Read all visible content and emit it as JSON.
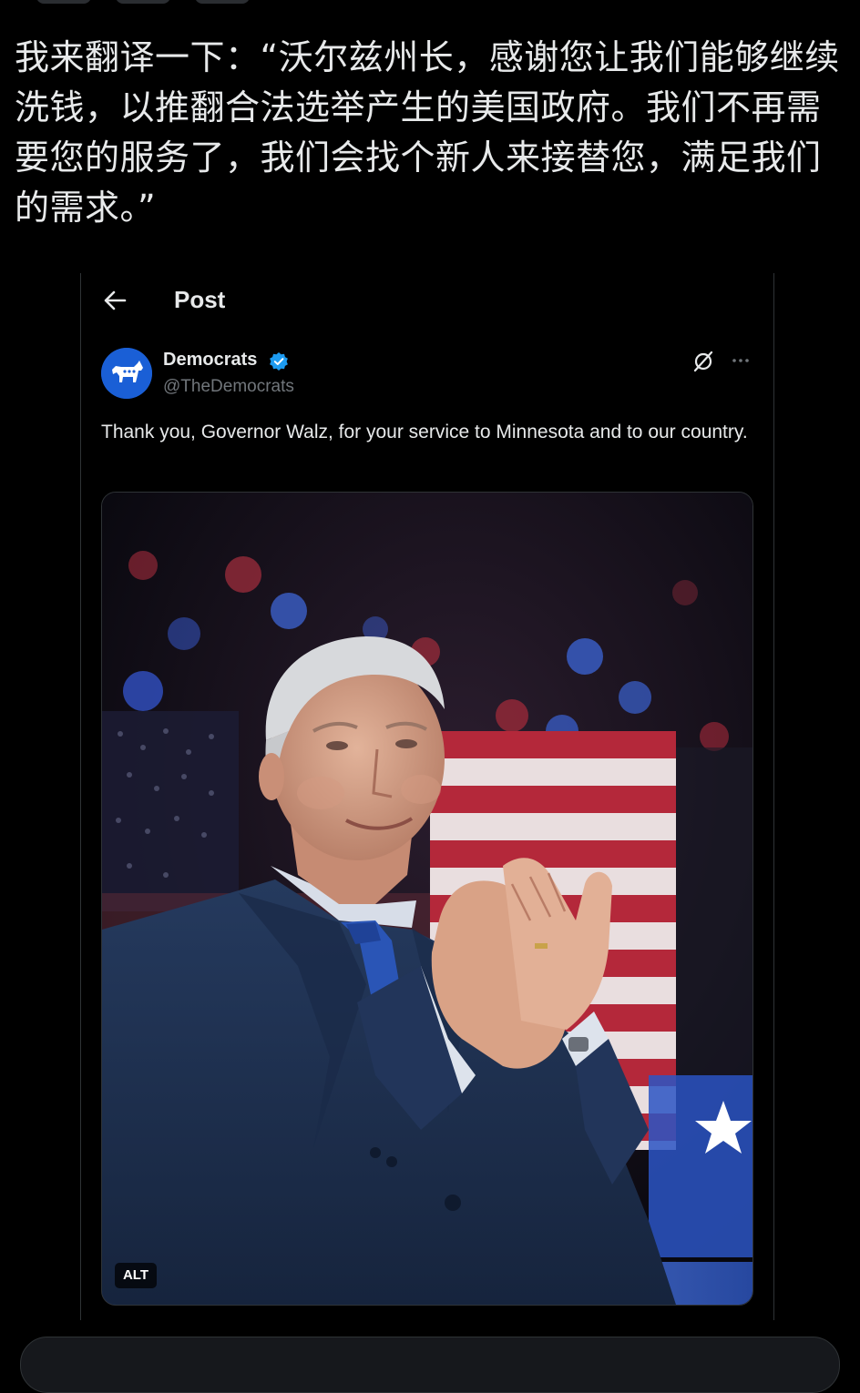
{
  "outer_post": {
    "text": "我来翻译一下：“沃尔兹州长，感谢您让我们能够继续洗钱，以推翻合法选举产生的美国政府。我们不再需要您的服务了，我们会找个新人来接替您，满足我们的需求。”"
  },
  "embedded_post": {
    "header_title": "Post",
    "author": {
      "name": "Democrats",
      "handle": "@TheDemocrats"
    },
    "text": "Thank you, Governor Walz, for your service to Minnesota and to our country.",
    "media": {
      "alt_label": "ALT"
    },
    "icons": {
      "back": "back-arrow-icon",
      "verified": "verified-badge-icon",
      "grok": "grok-icon",
      "more": "more-options-icon",
      "avatar": "democrats-donkey-logo"
    }
  },
  "colors": {
    "background": "#000000",
    "text": "#e7e9ea",
    "muted": "#71767b",
    "verified": "#1d9bf0",
    "avatar_bg": "#1a5fd6",
    "border": "#2f3336"
  }
}
